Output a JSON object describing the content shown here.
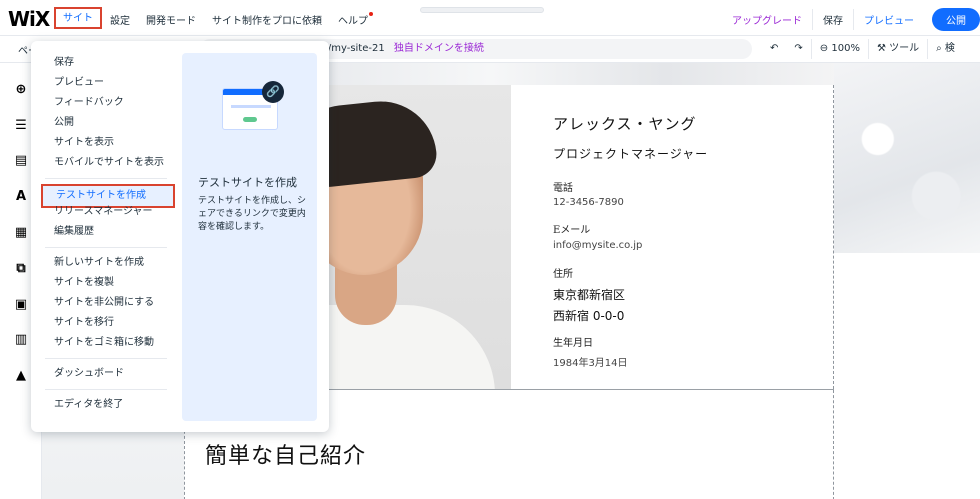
{
  "topbar": {
    "logo": "WiX",
    "nav": [
      {
        "label": "サイト",
        "active": true
      },
      {
        "label": "設定"
      },
      {
        "label": "開発モード"
      },
      {
        "label": "サイト制作をプロに依頼"
      },
      {
        "label": "ヘルプ"
      }
    ],
    "upgrade": "アップグレード",
    "save": "保存",
    "preview": "プレビュー",
    "publish": "公開"
  },
  "secbar": {
    "page_picker": "ペー",
    "url": "om/my-site-21",
    "connect_domain": "独自ドメインを接続",
    "undo_icon": "undo-icon",
    "redo_icon": "redo-icon",
    "zoom": "100%",
    "tools": "ツール",
    "search": "検"
  },
  "lefttoolbar": [
    "add-icon",
    "sections-icon",
    "pages-icon",
    "theme-icon",
    "apps-icon",
    "business-icon",
    "media-icon",
    "cms-icon",
    "app-market-icon"
  ],
  "menu": {
    "group1": [
      "保存",
      "プレビュー",
      "フィードバック",
      "公開",
      "サイトを表示",
      "モバイルでサイトを表示"
    ],
    "group2": [
      "テストサイトを作成",
      "リリースマネージャー",
      "編集履歴"
    ],
    "group3": [
      "新しいサイトを作成",
      "サイトを複製",
      "サイトを非公開にする",
      "サイトを移行",
      "サイトをゴミ箱に移動"
    ],
    "group4": [
      "ダッシュボード"
    ],
    "group5": [
      "エディタを終了"
    ],
    "highlighted": "テストサイトを作成",
    "panel": {
      "title": "テストサイトを作成",
      "description": "テストサイトを作成し、シェアできるリンクで変更内容を確認します。"
    }
  },
  "profile": {
    "name": "アレックス・ヤング",
    "job_title": "プロジェクトマネージャー",
    "phone_label": "電話",
    "phone": "12-3456-7890",
    "email_label": "Eメール",
    "email": "info@mysite.co.jp",
    "address_label": "住所",
    "address1": "東京都新宿区",
    "address2": "西新宿 0-0-0",
    "birthday_label": "生年月日",
    "birthday": "1984年3月14日"
  },
  "section_heading": "簡単な自己紹介",
  "colors": {
    "accent": "#116dff",
    "upgrade": "#9a27d5",
    "highlight_border": "#d9432f"
  }
}
